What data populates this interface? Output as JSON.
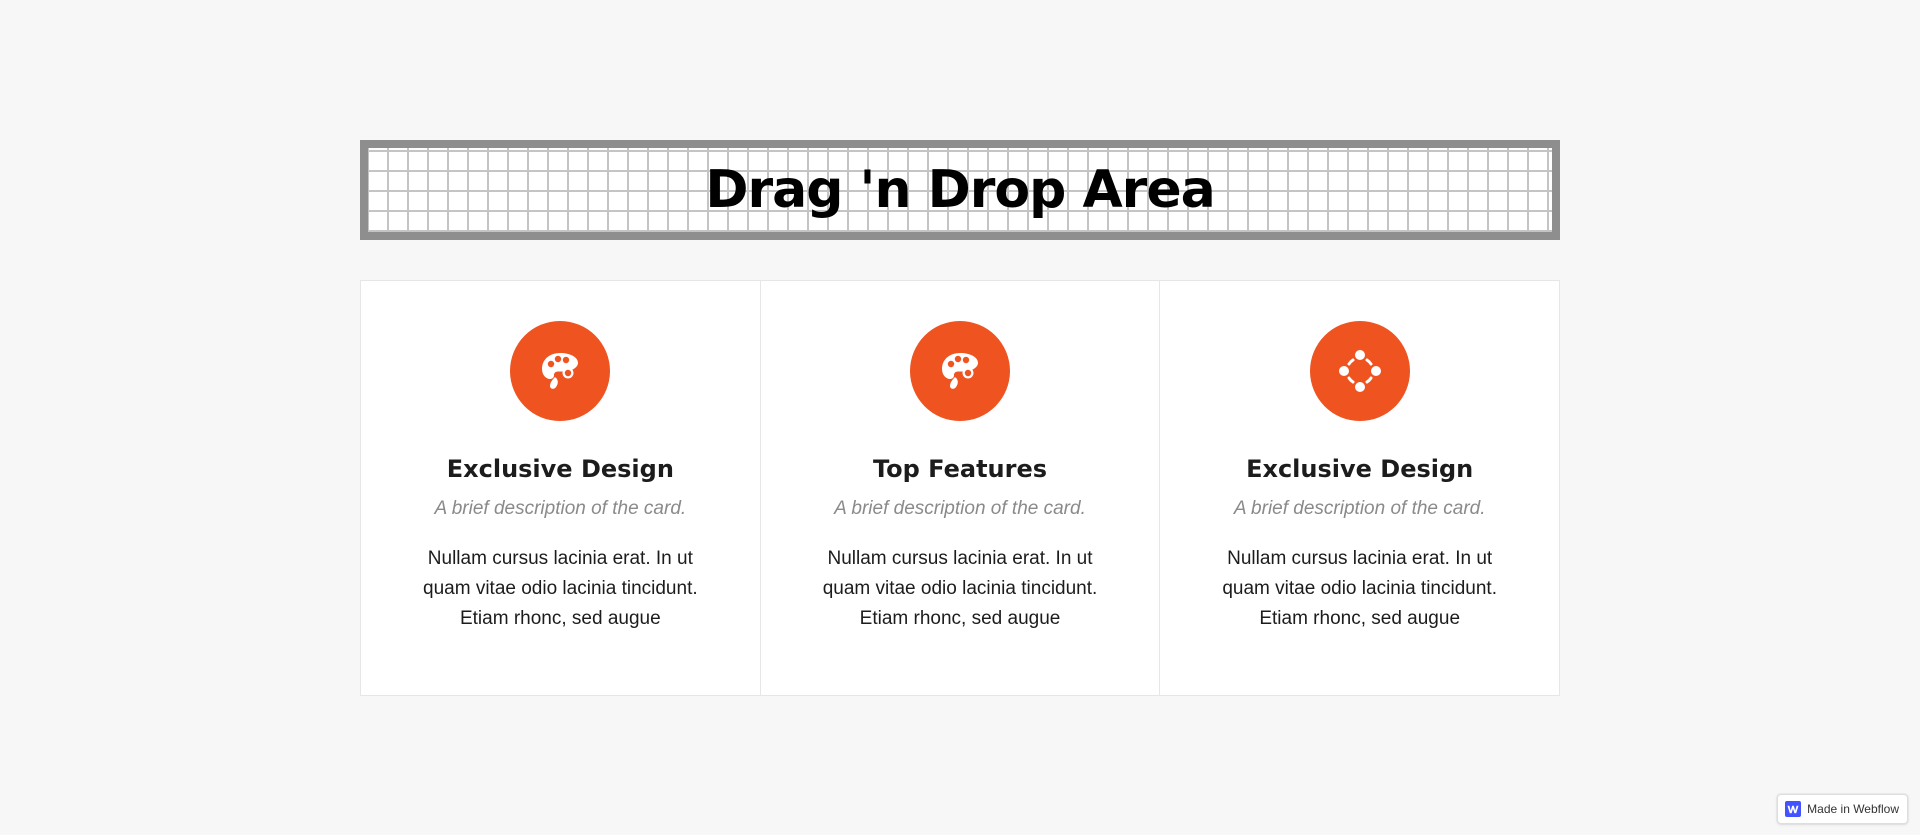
{
  "drop_area": {
    "title": "Drag 'n Drop Area"
  },
  "cards": [
    {
      "icon": "palette-icon",
      "title": "Exclusive Design",
      "subtitle": "A brief description of the card.",
      "body": "Nullam cursus lacinia erat. In ut quam vitae odio lacinia tincidunt. Etiam rhonc, sed augue"
    },
    {
      "icon": "palette-icon",
      "title": "Top Features",
      "subtitle": "A brief description of the card.",
      "body": "Nullam cursus lacinia erat. In ut quam vitae odio lacinia tincidunt. Etiam rhonc, sed augue"
    },
    {
      "icon": "circle-dots-icon",
      "title": "Exclusive Design",
      "subtitle": "A brief description of the card.",
      "body": "Nullam cursus lacinia erat. In ut quam vitae odio lacinia tincidunt. Etiam rhonc, sed augue"
    }
  ],
  "badge": {
    "label": "Made in Webflow",
    "icon": "webflow-logo-icon"
  },
  "colors": {
    "accent": "#ee5320",
    "background": "#f7f7f7",
    "webflow_blue": "#4353ff"
  }
}
